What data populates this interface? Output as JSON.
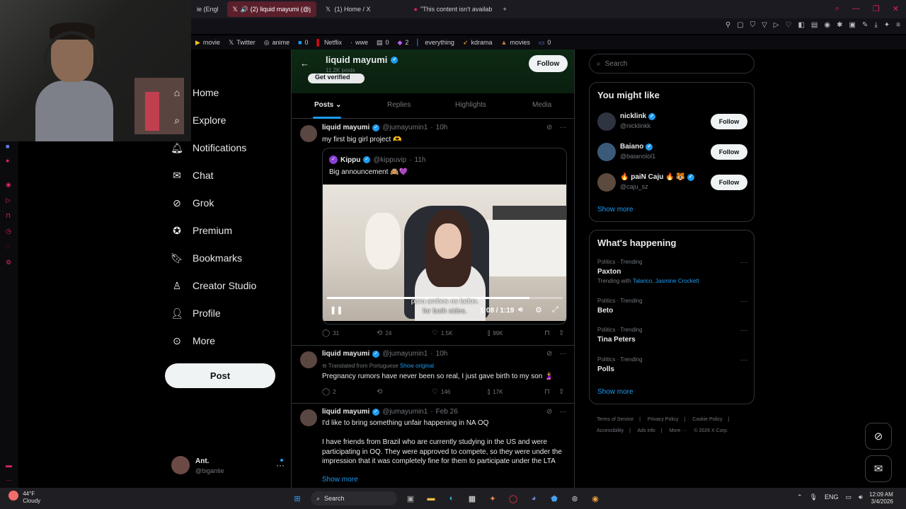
{
  "browser": {
    "tabs": [
      {
        "label": "ie (Engl",
        "active": false
      },
      {
        "label": "(2) liquid mayumi (@j",
        "active": true
      },
      {
        "label": "(1) Home / X",
        "active": false
      },
      {
        "label": "\"This content isn't availab",
        "active": false
      }
    ],
    "new_tab": "+",
    "bookmarks": [
      {
        "label": "movie",
        "icon": "play-icon"
      },
      {
        "label": "Twitter",
        "icon": "x-icon"
      },
      {
        "label": "anime",
        "icon": "anime-icon"
      },
      {
        "label": "0",
        "icon": "blue-square-icon"
      },
      {
        "label": "Netflix",
        "icon": "netflix-icon"
      },
      {
        "label": "wwe",
        "icon": "wwe-icon"
      },
      {
        "label": "0",
        "icon": "doc-icon"
      },
      {
        "label": "2",
        "icon": "purple-icon"
      },
      {
        "label": "everything",
        "icon": "bar-icon"
      },
      {
        "label": "kdrama",
        "icon": "kdrama-icon"
      },
      {
        "label": "movies",
        "icon": "movies-icon"
      },
      {
        "label": "0",
        "icon": "bookmark-icon"
      }
    ]
  },
  "nav": {
    "items": [
      {
        "label": "Home",
        "icon": "home-icon"
      },
      {
        "label": "Explore",
        "icon": "explore-icon"
      },
      {
        "label": "Notifications",
        "icon": "bell-icon"
      },
      {
        "label": "Chat",
        "icon": "mail-icon"
      },
      {
        "label": "Grok",
        "icon": "grok-icon"
      },
      {
        "label": "Premium",
        "icon": "premium-icon"
      },
      {
        "label": "Bookmarks",
        "icon": "bookmark-icon"
      },
      {
        "label": "Creator Studio",
        "icon": "creator-icon"
      },
      {
        "label": "Profile",
        "icon": "person-icon"
      },
      {
        "label": "More",
        "icon": "more-icon"
      }
    ],
    "post_label": "Post",
    "account": {
      "name": "Ant.",
      "handle": "@bigantie"
    }
  },
  "profile": {
    "name": "liquid mayumi",
    "posts_count": "11.2K posts",
    "get_verified": "Get verified",
    "follow": "Follow",
    "tabs": [
      "Posts",
      "Replies",
      "Highlights",
      "Media"
    ]
  },
  "tweets": [
    {
      "name": "liquid mayumi",
      "handle": "@jumayumin1",
      "time": "10h",
      "text": "my first big girl project 🫶",
      "quote": {
        "name": "Kippu",
        "handle": "@kippuvip",
        "time": "11h",
        "text": "Big announcement 🙈💜",
        "video": {
          "subtitle_1": "para ambos os lados.",
          "subtitle_2": "for both sides.",
          "time": "1:08 / 1:19",
          "progress": 0.86
        }
      },
      "replies": "31",
      "reposts": "24",
      "likes": "1.5K",
      "views": "99K"
    },
    {
      "name": "liquid mayumi",
      "handle": "@jumayumin1",
      "time": "10h",
      "translated": "Translated from Portuguese",
      "show_original": "Show original",
      "text": "Pregnancy rumors have never been so real, I just gave birth to my son 🤰",
      "replies": "2",
      "reposts": "",
      "likes": "146",
      "views": "17K"
    },
    {
      "name": "liquid mayumi",
      "handle": "@jumayumin1",
      "time": "Feb 26",
      "text": "I'd like to bring something unfair happening in NA OQ",
      "text2": "I have friends from Brazil who are currently studying in the US and were participating in OQ. They were approved to compete, so they were under the impression that it was completely fine for them to participate under the LTA",
      "show_more": "Show more"
    }
  ],
  "right": {
    "search_placeholder": "Search",
    "might_like_title": "You might like",
    "suggestions": [
      {
        "name": "nicklink",
        "handle": "@nicklinkk",
        "follow": "Follow"
      },
      {
        "name": "Baiano",
        "handle": "@baianolol1",
        "follow": "Follow"
      },
      {
        "name": "🔥 paiN Caju 🔥 🐯",
        "handle": "@caju_sz",
        "follow": "Follow"
      }
    ],
    "show_more": "Show more",
    "happening_title": "What's happening",
    "trends": [
      {
        "context": "Politics · Trending",
        "title": "Paxton",
        "with_prefix": "Trending with",
        "with_links": "Talarico, Jasmine Crockett"
      },
      {
        "context": "Politics · Trending",
        "title": "Beto"
      },
      {
        "context": "Politics · Trending",
        "title": "Tina Peters"
      },
      {
        "context": "Politics · Trending",
        "title": "Polls"
      }
    ],
    "show_more_2": "Show more",
    "footer": [
      "Terms of Service",
      "|",
      "Privacy Policy",
      "|",
      "Cookie Policy",
      "|",
      "Accessibility",
      "|",
      "Ads info",
      "|",
      "More ···",
      "© 2026 X Corp."
    ]
  },
  "taskbar": {
    "weather_temp": "44°F",
    "weather_desc": "Cloudy",
    "search": "Search",
    "lang": "ENG",
    "time": "12:09 AM",
    "date": "3/4/2026"
  }
}
